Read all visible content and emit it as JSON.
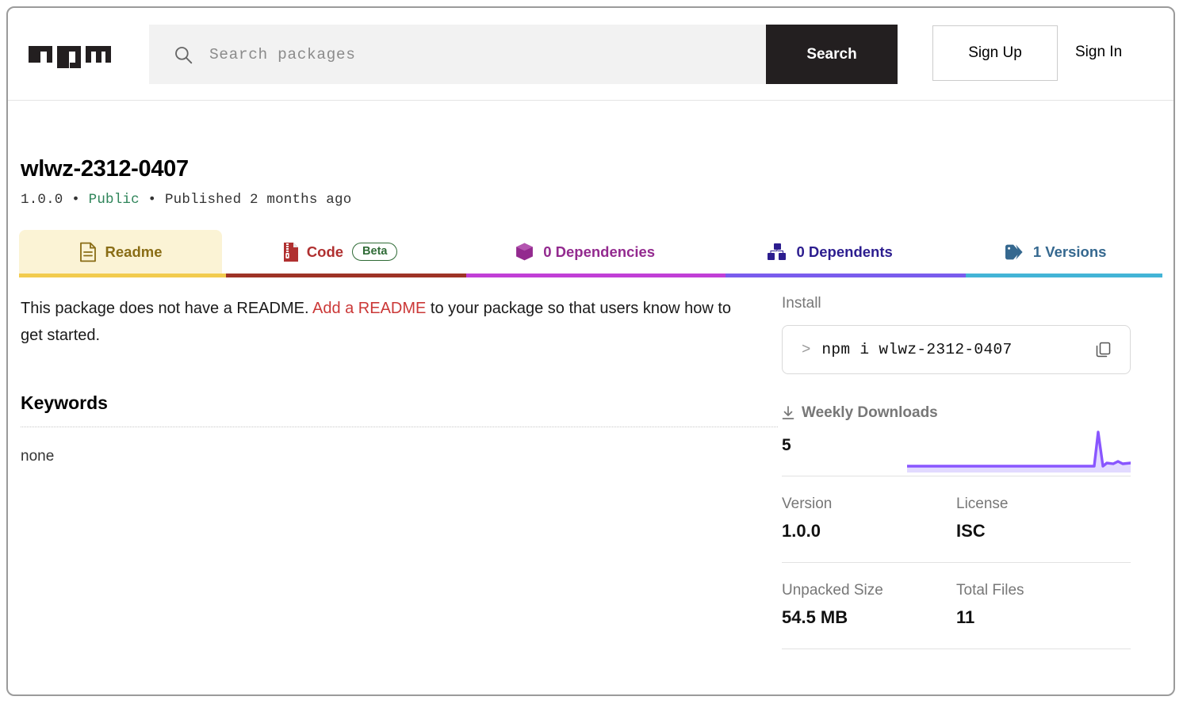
{
  "header": {
    "logo_name": "npm-logo",
    "search": {
      "placeholder": "Search packages",
      "value": "",
      "icon": "search-icon"
    },
    "search_button_label": "Search",
    "signup_label": "Sign Up",
    "signin_label": "Sign In"
  },
  "package": {
    "name": "wlwz-2312-0407",
    "version": "1.0.0",
    "visibility": "Public",
    "published": "Published 2 months ago",
    "separator": "•"
  },
  "tabs": [
    {
      "label": "Readme",
      "icon": "document-icon",
      "active": true
    },
    {
      "label": "Code",
      "icon": "zip-file-icon",
      "badge": "Beta",
      "active": false
    },
    {
      "label": "0 Dependencies",
      "icon": "package-box-icon",
      "active": false
    },
    {
      "label": "0 Dependents",
      "icon": "blocks-icon",
      "active": false
    },
    {
      "label": "1 Versions",
      "icon": "tag-icon",
      "active": false
    }
  ],
  "readme": {
    "text_before": "This package does not have a README. ",
    "link_text": "Add a README",
    "text_after": " to your package so that users know how to get started."
  },
  "keywords": {
    "title": "Keywords",
    "value": "none"
  },
  "sidebar": {
    "install_label": "Install",
    "install_prompt": ">",
    "install_command": "npm i wlwz-2312-0407",
    "copy_icon": "copy-icon",
    "downloads_label": "Weekly Downloads",
    "downloads_icon": "download-icon",
    "downloads_count": "5",
    "stats": [
      {
        "label": "Version",
        "value": "1.0.0"
      },
      {
        "label": "License",
        "value": "ISC"
      },
      {
        "label": "Unpacked Size",
        "value": "54.5 MB"
      },
      {
        "label": "Total Files",
        "value": "11"
      }
    ]
  },
  "chart_data": {
    "type": "line",
    "title": "Weekly Downloads",
    "values": [
      0,
      0,
      0,
      0,
      0,
      0,
      0,
      0,
      0,
      0,
      0,
      0,
      0,
      0,
      0,
      0,
      0,
      0,
      0,
      0,
      0,
      0,
      0,
      0,
      0,
      0,
      0,
      0,
      0,
      0,
      5,
      0,
      0.6,
      0.4,
      1,
      0.7,
      1
    ],
    "ylim": [
      0,
      5
    ],
    "xlabel": "",
    "ylabel": "",
    "grid": false,
    "legend": false,
    "line_color": "#8956ff",
    "fill_color": "#e2daff"
  },
  "colors": {
    "npm_red": "#cb3837",
    "dark": "#231f20",
    "readme_tab_bg": "#fbf3d5",
    "readme_tab_text": "#8a6d16",
    "readme_underline": "#f2cb4e",
    "code_underline": "#9e3327",
    "deps_underline": "#c13fd6",
    "dependents_underline": "#7a5ced",
    "versions_underline": "#43b4d6",
    "public_green": "#2f855a",
    "spark_purple": "#8956ff"
  }
}
